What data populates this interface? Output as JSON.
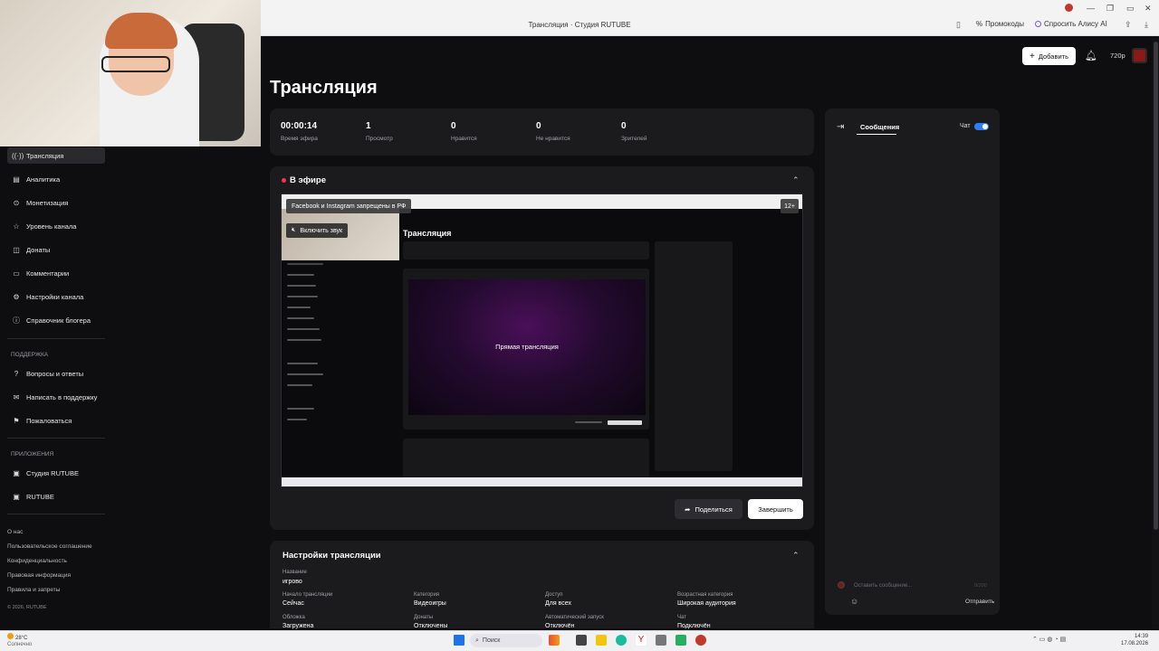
{
  "browser": {
    "window_title": "Трансляция · Студия RUTUBE",
    "promo_label": "Промокоды",
    "alice_label": "Спросить Алису AI"
  },
  "header": {
    "add_label": "Добавить",
    "quality": "720p"
  },
  "page_title": "Трансляция",
  "sidebar": {
    "items": [
      {
        "label": "Трансляция",
        "icon": "broadcast-icon",
        "active": true
      },
      {
        "label": "Аналитика",
        "icon": "analytics-icon"
      },
      {
        "label": "Монетизация",
        "icon": "monetization-icon"
      },
      {
        "label": "Уровень канала",
        "icon": "star-icon"
      },
      {
        "label": "Донаты",
        "icon": "donate-icon"
      },
      {
        "label": "Комментарии",
        "icon": "comment-icon"
      },
      {
        "label": "Настройки канала",
        "icon": "gear-icon"
      },
      {
        "label": "Справочник блогера",
        "icon": "info-icon"
      }
    ],
    "support_label": "ПОДДЕРЖКА",
    "support_items": [
      {
        "label": "Вопросы и ответы",
        "icon": "help-icon"
      },
      {
        "label": "Написать в поддержку",
        "icon": "mail-icon"
      },
      {
        "label": "Пожаловаться",
        "icon": "flag-icon"
      }
    ],
    "apps_label": "ПРИЛОЖЕНИЯ",
    "app_items": [
      {
        "label": "Студия RUTUBE",
        "icon": "studio-icon"
      },
      {
        "label": "RUTUBE",
        "icon": "rutube-icon"
      }
    ],
    "footer_links": [
      "О нас",
      "Пользовательское соглашение",
      "Конфиденциальность",
      "Правовая информация",
      "Правила и запреты"
    ],
    "copyright": "© 2026, RUTUBE"
  },
  "stats": [
    {
      "value": "00:00:14",
      "label": "Время эфира"
    },
    {
      "value": "1",
      "label": "Просмотр"
    },
    {
      "value": "0",
      "label": "Нравится"
    },
    {
      "value": "0",
      "label": "Не нравится"
    },
    {
      "value": "0",
      "label": "Зрителей"
    }
  ],
  "live": {
    "title": "В эфире",
    "banner": "Facebook и Instagram запрещены в РФ",
    "age": "12+",
    "sound_label": "Включить звук",
    "preview_title": "Трансляция",
    "preview_video_text": "Прямая трансляция",
    "share_label": "Поделиться",
    "end_label": "Завершить"
  },
  "settings": {
    "title": "Настройки трансляции",
    "name_label": "Название",
    "name_value": "игрово",
    "fields": [
      {
        "label": "Начало трансляции",
        "value": "Сейчас"
      },
      {
        "label": "Категория",
        "value": "Видеоигры"
      },
      {
        "label": "Доступ",
        "value": "Для всех"
      },
      {
        "label": "Возрастная категория",
        "value": "Широкая аудитория"
      },
      {
        "label": "Обложка",
        "value": "Загружена"
      },
      {
        "label": "Донаты",
        "value": "Отключены"
      },
      {
        "label": "Автоматический запуск",
        "value": "Отключён"
      },
      {
        "label": "Чат",
        "value": "Подключён"
      }
    ]
  },
  "chat": {
    "tab_label": "Сообщения",
    "toggle_label": "Чат",
    "input_placeholder": "Оставить сообщение...",
    "counter": "0/200",
    "send_label": "Отправить"
  },
  "taskbar": {
    "weather_temp": "28°C",
    "weather_desc": "Солнечно",
    "search_label": "Поиск",
    "time": "14:39",
    "date": "17.08.2026"
  }
}
